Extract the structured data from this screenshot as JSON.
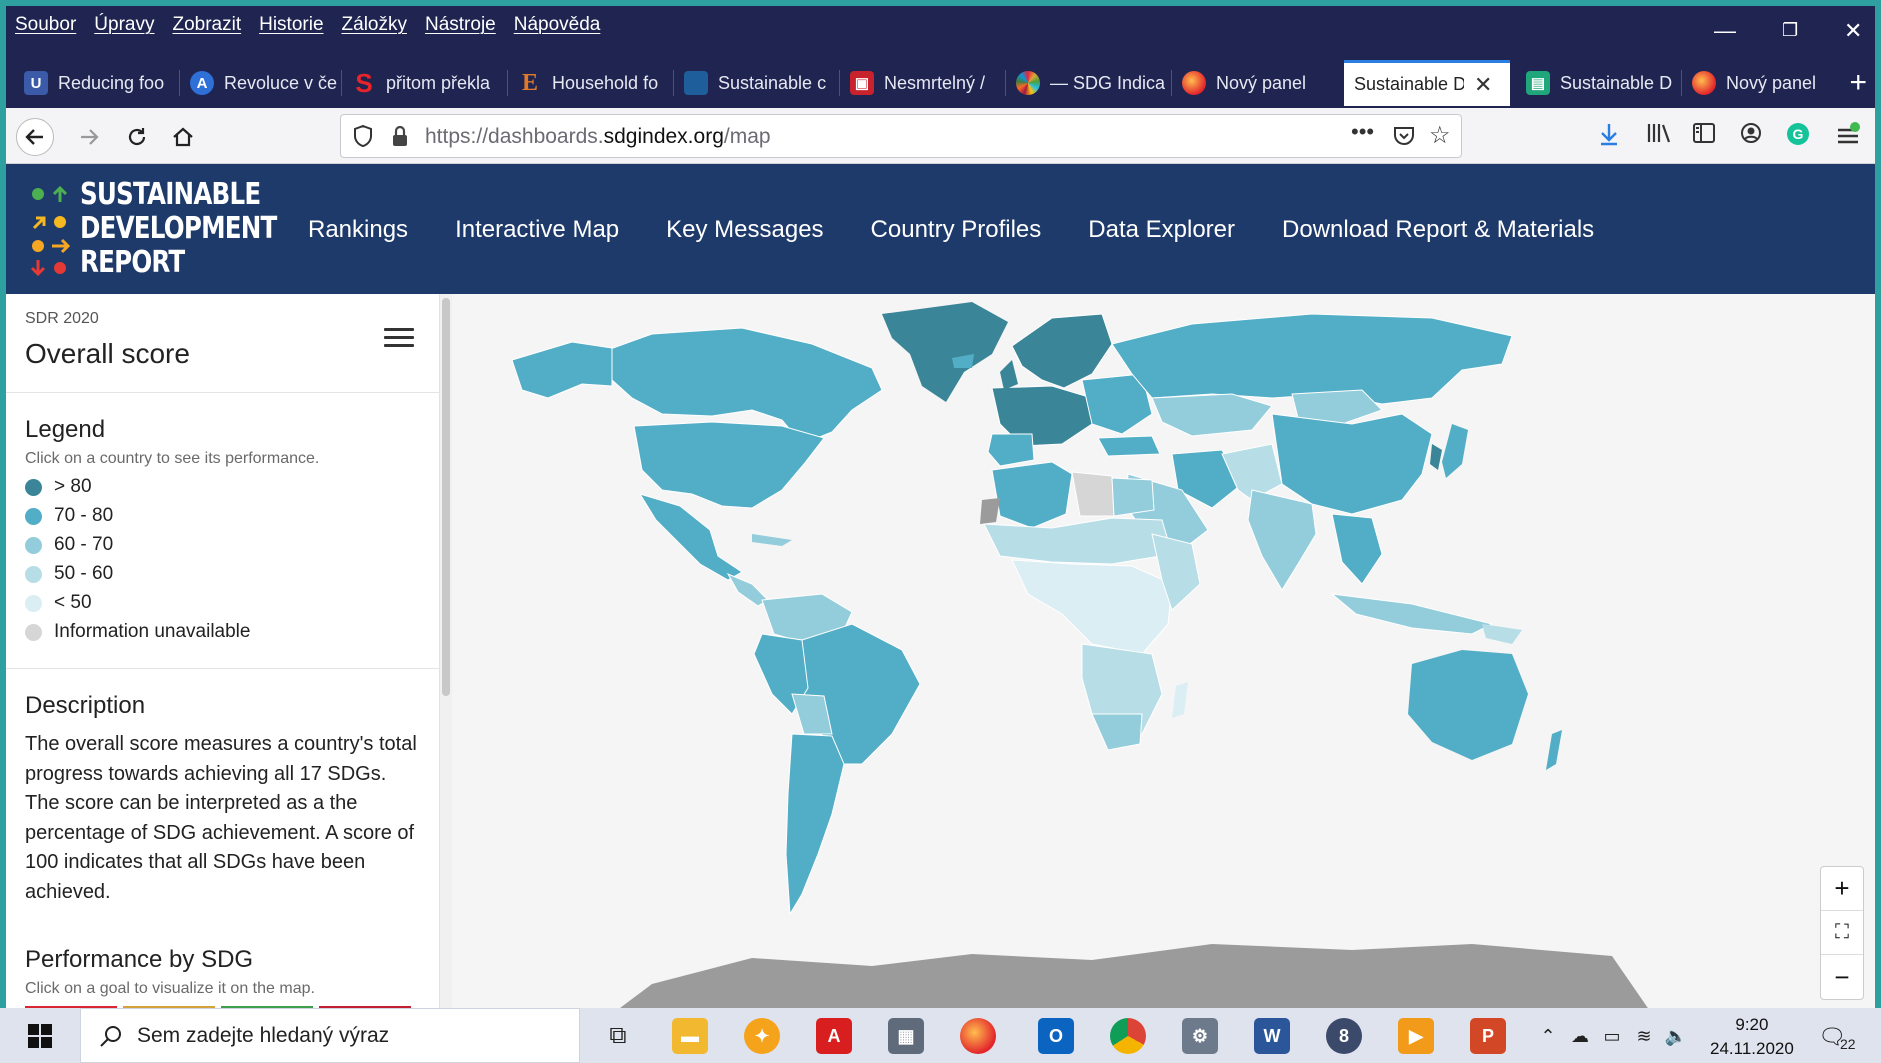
{
  "menubar": {
    "items": [
      "Soubor",
      "Úpravy",
      "Zobrazit",
      "Historie",
      "Záložky",
      "Nástroje",
      "Nápověda"
    ]
  },
  "tabs": [
    {
      "label": "Reducing foo",
      "color": "#3b5ba8",
      "icon": "shield-icon",
      "glyph": "U"
    },
    {
      "label": "Revoluce v če",
      "color": "#2f6fd8",
      "icon": "a-icon",
      "glyph": "A"
    },
    {
      "label": "přitom překla",
      "color": "#d8232a",
      "icon": "s-icon",
      "glyph": "S"
    },
    {
      "label": "Household fo",
      "color": "#c76a1e",
      "icon": "e-icon",
      "glyph": "E"
    },
    {
      "label": "Sustainable c",
      "color": "#1d5e9b",
      "icon": "un-icon",
      "glyph": "▬"
    },
    {
      "label": "Nesmrtelný /",
      "color": "#c8222c",
      "icon": "picture-icon",
      "glyph": "▣"
    },
    {
      "label": "— SDG Indica",
      "color": "#e4a12a",
      "icon": "sdg-wheel-icon",
      "glyph": "✺"
    },
    {
      "label": "Nový panel",
      "color": "#e66a1e",
      "icon": "firefox-icon",
      "glyph": "●"
    },
    {
      "label": "Sustainable De",
      "color": "#ffffff",
      "icon": "page-icon",
      "glyph": ""
    },
    {
      "label": "Sustainable D",
      "color": "#1fa67a",
      "icon": "teams-icon",
      "glyph": "▤"
    },
    {
      "label": "Nový panel",
      "color": "#e66a1e",
      "icon": "firefox-icon",
      "glyph": "●"
    }
  ],
  "nav": {
    "url_prefix": "https://dashboards.",
    "url_domain": "sdgindex.org",
    "url_path": "/map"
  },
  "site": {
    "logo_lines": [
      "SUSTAINABLE",
      "DEVELOPMENT",
      "REPORT"
    ],
    "nav": [
      "Rankings",
      "Interactive Map",
      "Key Messages",
      "Country Profiles",
      "Data Explorer",
      "Download Report & Materials"
    ]
  },
  "sidebar": {
    "edition": "SDR 2020",
    "title": "Overall score",
    "legend_title": "Legend",
    "legend_hint": "Click on a country to see its performance.",
    "legend": [
      {
        "label": "> 80",
        "color": "#3a8598"
      },
      {
        "label": "70 - 80",
        "color": "#52adc6"
      },
      {
        "label": "60 - 70",
        "color": "#93cddb"
      },
      {
        "label": "50 - 60",
        "color": "#b7dde7"
      },
      {
        "label": "< 50",
        "color": "#daeef3"
      },
      {
        "label": "Information unavailable",
        "color": "#d6d6d6"
      }
    ],
    "description_title": "Description",
    "description": "The overall score measures a country's total progress towards achieving all 17 SDGs. The score can be interpreted as a the percentage of SDG achievement. A score of 100 indicates that all SDGs have been achieved.",
    "performance_title": "Performance by SDG",
    "performance_hint": "Click on a goal to visualize it on the map.",
    "sdg_colors": [
      "#d82633",
      "#d4a23a",
      "#3fa04b",
      "#c31f33"
    ]
  },
  "taskbar": {
    "search_placeholder": "Sem zadejte hledaný výraz",
    "time": "9:20",
    "date": "24.11.2020",
    "notifications": "22"
  }
}
